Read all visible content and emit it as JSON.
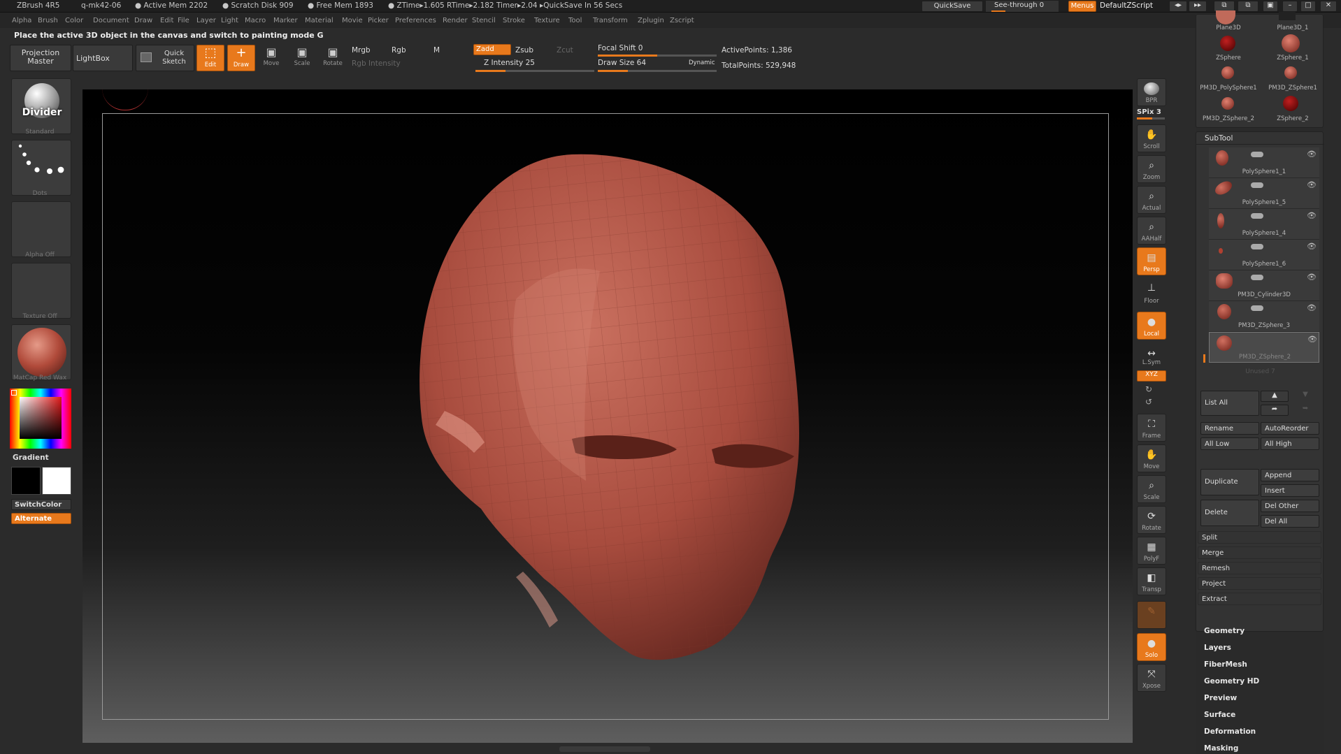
{
  "app": {
    "title": "ZBrush 4R5",
    "file": "q-mk42-06",
    "active_mem": "● Active Mem 2202",
    "scratch_disk": "● Scratch Disk 909",
    "free_mem": "● Free Mem 1893",
    "ztime": "● ZTime▸1.605 RTime▸2.182 Timer▸2.04 ▸QuickSave In 56 Secs",
    "quicksave": "QuickSave",
    "see_through": "See-through  0",
    "menus": "Menus",
    "script": "DefaultZScript"
  },
  "menus": [
    "Alpha",
    "Brush",
    "Color",
    "Document",
    "Draw",
    "Edit",
    "File",
    "Layer",
    "Light",
    "Macro",
    "Marker",
    "Material",
    "Movie",
    "Picker",
    "Preferences",
    "Render",
    "Stencil",
    "Stroke",
    "Texture",
    "Tool",
    "Transform",
    "Zplugin",
    "Zscript"
  ],
  "info_line": "Place the active 3D object in the canvas and switch to painting mode  G",
  "toolbar": {
    "projection_master": "Projection Master",
    "lightbox": "LightBox",
    "quick_sketch": "Quick Sketch",
    "edit": "Edit",
    "draw": "Draw",
    "move": "Move",
    "scale": "Scale",
    "rotate": "Rotate",
    "mrgb": "Mrgb",
    "rgb": "Rgb",
    "m": "M",
    "rgb_intensity": "Rgb Intensity",
    "zadd": "Zadd",
    "zsub": "Zsub",
    "zcut": "Zcut",
    "z_intensity": "Z Intensity 25",
    "focal_shift": "Focal Shift 0",
    "draw_size": "Draw Size 64",
    "dynamic": "Dynamic",
    "active_points": "ActivePoints: 1,386",
    "total_points": "TotalPoints: 529,948",
    "z_intensity_level": 0.25,
    "draw_size_level": 0.25,
    "focal_shift_level": 0.5
  },
  "left": {
    "brush": "Divider",
    "brush_cap": "Standard",
    "stroke_cap": "Dots",
    "alpha_cap": "Alpha  Off",
    "texture_cap": "Texture  Off",
    "material_cap": "MatCap  Red  Wax",
    "gradient": "Gradient",
    "switch_color": "SwitchColor",
    "alternate": "Alternate"
  },
  "right_shelf": {
    "bpr": "BPR",
    "spix": "SPix 3",
    "buttons": [
      "Scroll",
      "Zoom",
      "Actual",
      "AAHalf",
      "Persp",
      "Floor",
      "Local",
      "L.Sym",
      "XYZ",
      "",
      "",
      "Frame",
      "Move",
      "Scale",
      "Rotate",
      "PolyF",
      "Transp",
      "",
      "Solo",
      "Xpose"
    ]
  },
  "tray": {
    "tools": [
      "Plane3D",
      "Plane3D_1",
      "ZSphere",
      "ZSphere_1",
      "PM3D_PolySphere1",
      "PM3D_ZSphere1",
      "PM3D_ZSphere_2",
      "ZSphere_2"
    ],
    "subtool_title": "SubTool",
    "subtools": [
      "PolySphere1_1",
      "PolySphere1_5",
      "PolySphere1_4",
      "PolySphere1_6",
      "PM3D_Cylinder3D",
      "PM3D_ZSphere_3",
      "PM3D_ZSphere_2"
    ],
    "unused": "Unused  7",
    "list_all": "List  All",
    "rename": "Rename",
    "auto_reorder": "AutoReorder",
    "all_low": "All  Low",
    "all_high": "All  High",
    "duplicate": "Duplicate",
    "append": "Append",
    "insert": "Insert",
    "delete": "Delete",
    "del_other": "Del  Other",
    "del_all": "Del  All",
    "split": "Split",
    "merge": "Merge",
    "remesh": "Remesh",
    "project": "Project",
    "extract": "Extract",
    "sections": [
      "Geometry",
      "Layers",
      "FiberMesh",
      "Geometry  HD",
      "Preview",
      "Surface",
      "Deformation",
      "Masking"
    ]
  },
  "colors": {
    "accent": "#e8791c",
    "model": "#b8564a",
    "bg": "#2b2b2b"
  }
}
